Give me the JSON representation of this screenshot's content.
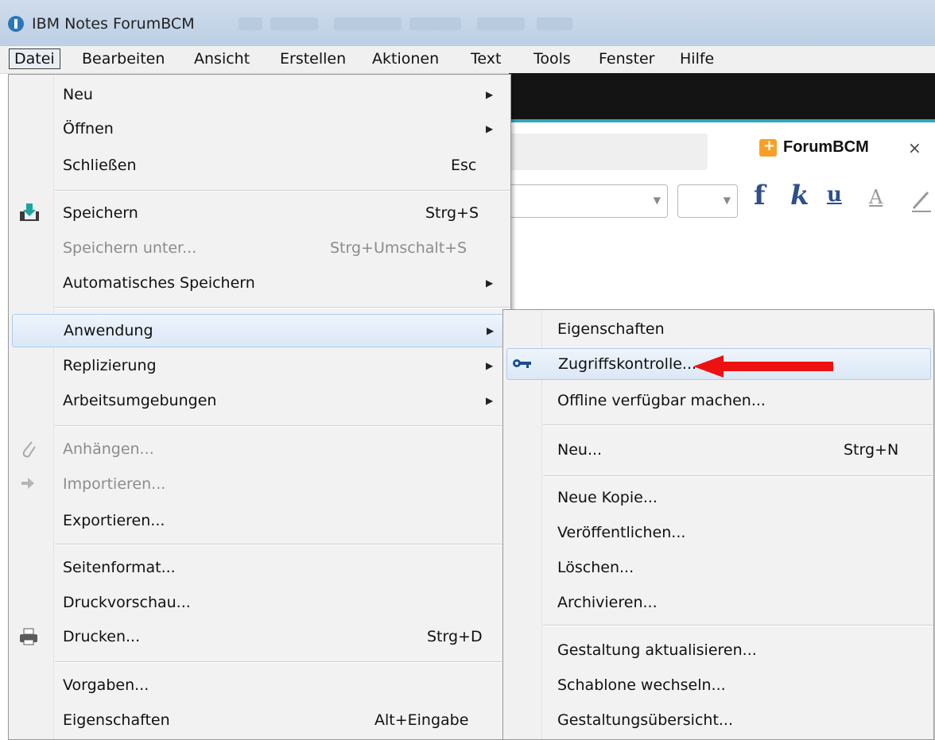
{
  "window": {
    "title": "IBM Notes ForumBCM"
  },
  "menubar": [
    "Datei",
    "Bearbeiten",
    "Ansicht",
    "Erstellen",
    "Aktionen",
    "Text",
    "Tools",
    "Fenster",
    "Hilfe"
  ],
  "background": {
    "tab_label": "ForumBCM",
    "tab_close": "×",
    "format_buttons": {
      "bold": "f",
      "italic": "k",
      "underline": "u",
      "color": "A"
    }
  },
  "file_menu": {
    "neu": "Neu",
    "oeffnen": "Öffnen",
    "schliessen": "Schließen",
    "schliessen_shortcut": "Esc",
    "speichern": "Speichern",
    "speichern_shortcut": "Strg+S",
    "speichern_unter": "Speichern unter...",
    "speichern_unter_shortcut": "Strg+Umschalt+S",
    "auto_speichern": "Automatisches Speichern",
    "anwendung": "Anwendung",
    "replizierung": "Replizierung",
    "arbeitsumgebungen": "Arbeitsumgebungen",
    "anhaengen": "Anhängen...",
    "importieren": "Importieren...",
    "exportieren": "Exportieren...",
    "seitenformat": "Seitenformat...",
    "druckvorschau": "Druckvorschau...",
    "drucken": "Drucken...",
    "drucken_shortcut": "Strg+D",
    "vorgaben": "Vorgaben...",
    "eigenschaften": "Eigenschaften",
    "eigenschaften_shortcut": "Alt+Eingabe"
  },
  "submenu": {
    "eigenschaften": "Eigenschaften",
    "zugriffskontrolle": "Zugriffskontrolle...",
    "offline": "Offline verfügbar machen...",
    "neu": "Neu...",
    "neu_shortcut": "Strg+N",
    "neue_kopie": "Neue Kopie...",
    "veroeffentlichen": "Veröffentlichen...",
    "loeschen": "Löschen...",
    "archivieren": "Archivieren...",
    "gestaltung_aktualisieren": "Gestaltung aktualisieren...",
    "schablone_wechseln": "Schablone wechseln...",
    "gestaltungsuebersicht": "Gestaltungsübersicht..."
  },
  "colors": {
    "highlight": "#dce8f6",
    "arrow": "#ee1111",
    "accent_line": "#2fa6b9"
  }
}
